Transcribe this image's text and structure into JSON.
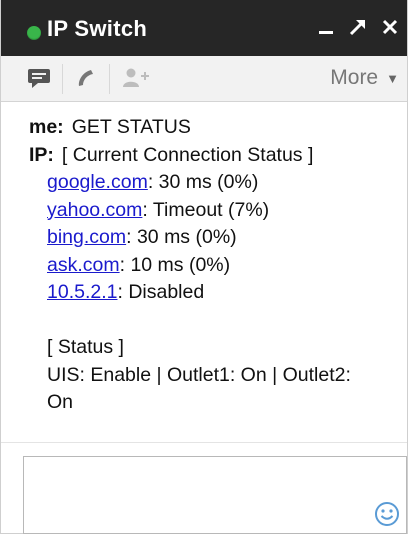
{
  "window": {
    "title": "IP Switch",
    "status_color": "#39b54a"
  },
  "toolbar": {
    "icons": [
      "chat-bubble-icon",
      "phone-icon",
      "add-person-icon"
    ],
    "more_label": "More",
    "more_caret": "▼"
  },
  "conversation": {
    "messages": [
      {
        "speaker": "me:",
        "text": "GET STATUS"
      },
      {
        "speaker": "IP:",
        "text": "[ Current Connection Status ]"
      }
    ],
    "status_rows": [
      {
        "host": "google.com",
        "result": ": 30 ms (0%)"
      },
      {
        "host": "yahoo.com",
        "result": ": Timeout (7%)"
      },
      {
        "host": "bing.com",
        "result": ": 30 ms (0%)"
      },
      {
        "host": "ask.com",
        "result": ": 10 ms (0%)"
      },
      {
        "host": "10.5.2.1",
        "result": ": Disabled"
      }
    ],
    "status_header": "[ Status ]",
    "status_detail": "UIS: Enable | Outlet1: On | Outlet2: On"
  },
  "compose": {
    "value": "",
    "emoji_icon": "smiley-icon"
  },
  "colors": {
    "titlebar_bg": "#262626",
    "link": "#1a1acc",
    "toolbar_bg": "#f2f2f2"
  }
}
